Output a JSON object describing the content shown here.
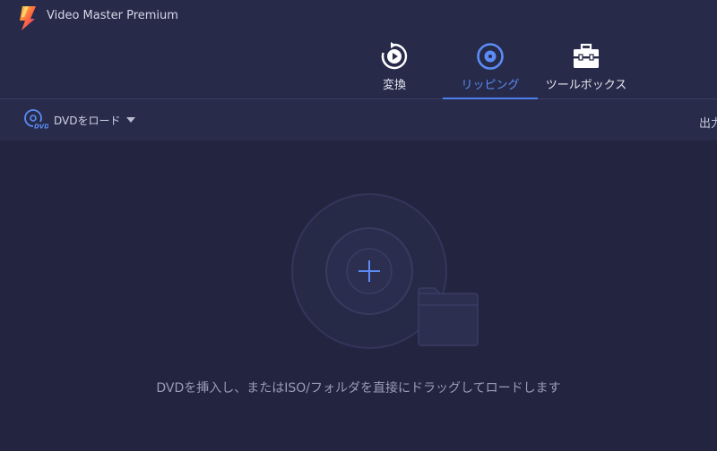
{
  "app": {
    "title": "Video Master Premium"
  },
  "tabs": [
    {
      "label": "変換",
      "icon": "convert-icon",
      "active": false
    },
    {
      "label": "リッピング",
      "icon": "ripper-disc-icon",
      "active": true
    },
    {
      "label": "ツールボックス",
      "icon": "toolbox-icon",
      "active": false
    }
  ],
  "toolbar": {
    "load_dvd_label": "DVDをロード",
    "load_dvd_icon": "dvd-icon",
    "output_label": "出力"
  },
  "main": {
    "drop_hint": "DVDを挿入し、またはISO/フォルダを直接にドラッグしてロードします",
    "drop_icon": "disc-folder-add-icon"
  },
  "colors": {
    "background": "#222440",
    "header": "#272a49",
    "accent": "#4d7ff0"
  }
}
